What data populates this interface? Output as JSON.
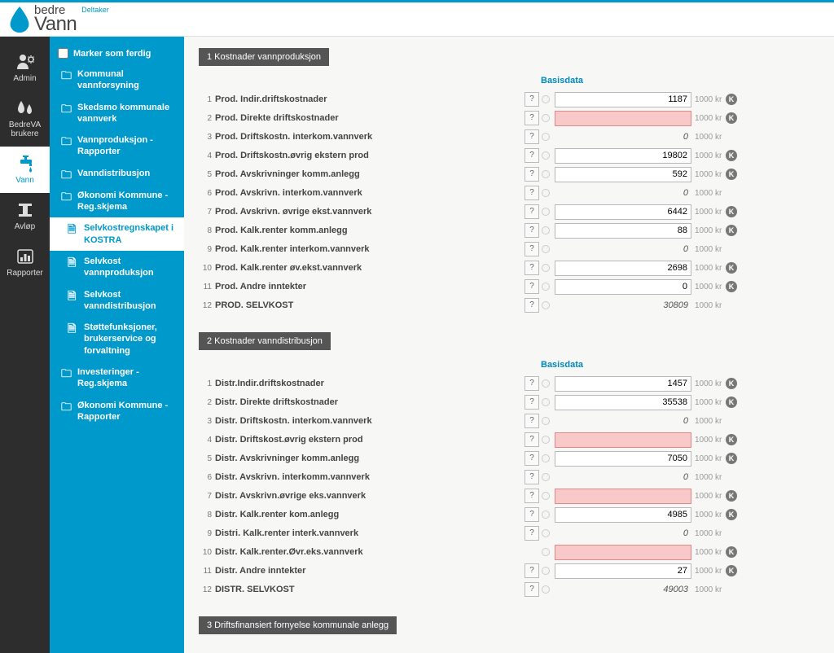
{
  "brand": {
    "bedre": "bedre",
    "vann": "Vann",
    "deltaker": "Deltaker"
  },
  "rail": {
    "admin": "Admin",
    "bedreva": "BedreVA brukere",
    "vann": "Vann",
    "avlop": "Avløp",
    "rapporter": "Rapporter"
  },
  "sidebar": {
    "marker": "Marker som ferdig",
    "items": [
      {
        "type": "folder",
        "label": "Kommunal vannforsyning"
      },
      {
        "type": "folder",
        "label": "Skedsmo kommunale vannverk"
      },
      {
        "type": "folder",
        "label": "Vannproduksjon - Rapporter"
      },
      {
        "type": "folder",
        "label": "Vanndistribusjon"
      },
      {
        "type": "folder",
        "label": "Økonomi Kommune - Reg.skjema"
      },
      {
        "type": "doc",
        "sub": true,
        "active": true,
        "label": "Selvkostregnskapet i KOSTRA"
      },
      {
        "type": "doc",
        "sub": true,
        "label": "Selvkost vannproduksjon"
      },
      {
        "type": "doc",
        "sub": true,
        "label": "Selvkost vanndistribusjon"
      },
      {
        "type": "doc",
        "sub": true,
        "label": "Støttefunksjoner, brukerservice og forvaltning"
      },
      {
        "type": "folder",
        "label": "Investeringer - Reg.skjema"
      },
      {
        "type": "folder",
        "label": "Økonomi Kommune - Rapporter"
      }
    ]
  },
  "labels": {
    "basisdata": "Basisdata",
    "unit": "1000 kr",
    "help": "?",
    "k": "K"
  },
  "sections": [
    {
      "num": "1",
      "title": "Kostnader vannproduksjon",
      "basisdata": true,
      "rows": [
        {
          "n": "1",
          "label": "Prod. Indir.driftskostnader",
          "help": true,
          "input": true,
          "value": "1187",
          "k": true
        },
        {
          "n": "2",
          "label": "Prod. Direkte driftskostnader",
          "help": true,
          "input": true,
          "value": "",
          "error": true,
          "k": true
        },
        {
          "n": "3",
          "label": "Prod. Driftskostn. interkom.vannverk",
          "help": true,
          "readonly": true,
          "value": "0"
        },
        {
          "n": "4",
          "label": "Prod. Driftskostn.øvrig ekstern prod",
          "help": true,
          "input": true,
          "value": "19802",
          "k": true
        },
        {
          "n": "5",
          "label": "Prod. Avskrivninger komm.anlegg",
          "help": true,
          "input": true,
          "value": "592",
          "k": true
        },
        {
          "n": "6",
          "label": "Prod. Avskrivn. interkom.vannverk",
          "help": true,
          "readonly": true,
          "value": "0"
        },
        {
          "n": "7",
          "label": "Prod. Avskrivn. øvrige ekst.vannverk",
          "help": true,
          "input": true,
          "value": "6442",
          "k": true
        },
        {
          "n": "8",
          "label": "Prod. Kalk.renter komm.anlegg",
          "help": true,
          "input": true,
          "value": "88",
          "k": true
        },
        {
          "n": "9",
          "label": "Prod. Kalk.renter interkom.vannverk",
          "help": true,
          "readonly": true,
          "value": "0"
        },
        {
          "n": "10",
          "label": "Prod. Kalk.renter øv.ekst.vannverk",
          "help": true,
          "input": true,
          "value": "2698",
          "k": true
        },
        {
          "n": "11",
          "label": "Prod. Andre inntekter",
          "help": true,
          "input": true,
          "value": "0",
          "k": true
        },
        {
          "n": "12",
          "label": "PROD. SELVKOST",
          "help": true,
          "readonly": true,
          "total": true,
          "value": "30809"
        }
      ]
    },
    {
      "num": "2",
      "title": "Kostnader vanndistribusjon",
      "basisdata": true,
      "rows": [
        {
          "n": "1",
          "label": "Distr.Indir.driftskostnader",
          "help": true,
          "input": true,
          "value": "1457",
          "k": true
        },
        {
          "n": "2",
          "label": "Distr. Direkte driftskostnader",
          "help": true,
          "input": true,
          "value": "35538",
          "k": true
        },
        {
          "n": "3",
          "label": "Distr. Driftskostn. interkom.vannverk",
          "help": true,
          "readonly": true,
          "value": "0"
        },
        {
          "n": "4",
          "label": "Distr. Driftskost.øvrig ekstern prod",
          "help": true,
          "input": true,
          "value": "",
          "error": true,
          "k": true
        },
        {
          "n": "5",
          "label": "Distr. Avskrivninger komm.anlegg",
          "help": true,
          "input": true,
          "value": "7050",
          "k": true
        },
        {
          "n": "6",
          "label": "Distr. Avskrivn. interkomm.vannverk",
          "help": true,
          "readonly": true,
          "value": "0"
        },
        {
          "n": "7",
          "label": "Distr. Avskrivn.øvrige eks.vannverk",
          "help": true,
          "input": true,
          "value": "",
          "error": true,
          "k": true
        },
        {
          "n": "8",
          "label": "Distr. Kalk.renter kom.anlegg",
          "help": true,
          "input": true,
          "value": "4985",
          "k": true
        },
        {
          "n": "9",
          "label": "Distri. Kalk.renter interk.vannverk",
          "help": true,
          "readonly": true,
          "value": "0"
        },
        {
          "n": "10",
          "label": "Distr. Kalk.renter.Øvr.eks.vannverk",
          "help": false,
          "input": true,
          "value": "",
          "error": true,
          "k": true
        },
        {
          "n": "11",
          "label": "Distr. Andre inntekter",
          "help": true,
          "input": true,
          "value": "27",
          "k": true
        },
        {
          "n": "12",
          "label": "DISTR. SELVKOST",
          "help": true,
          "readonly": true,
          "total": true,
          "value": "49003"
        }
      ]
    },
    {
      "num": "3",
      "title": "Driftsfinansiert fornyelse kommunale anlegg",
      "basisdata": false,
      "rows": []
    }
  ]
}
